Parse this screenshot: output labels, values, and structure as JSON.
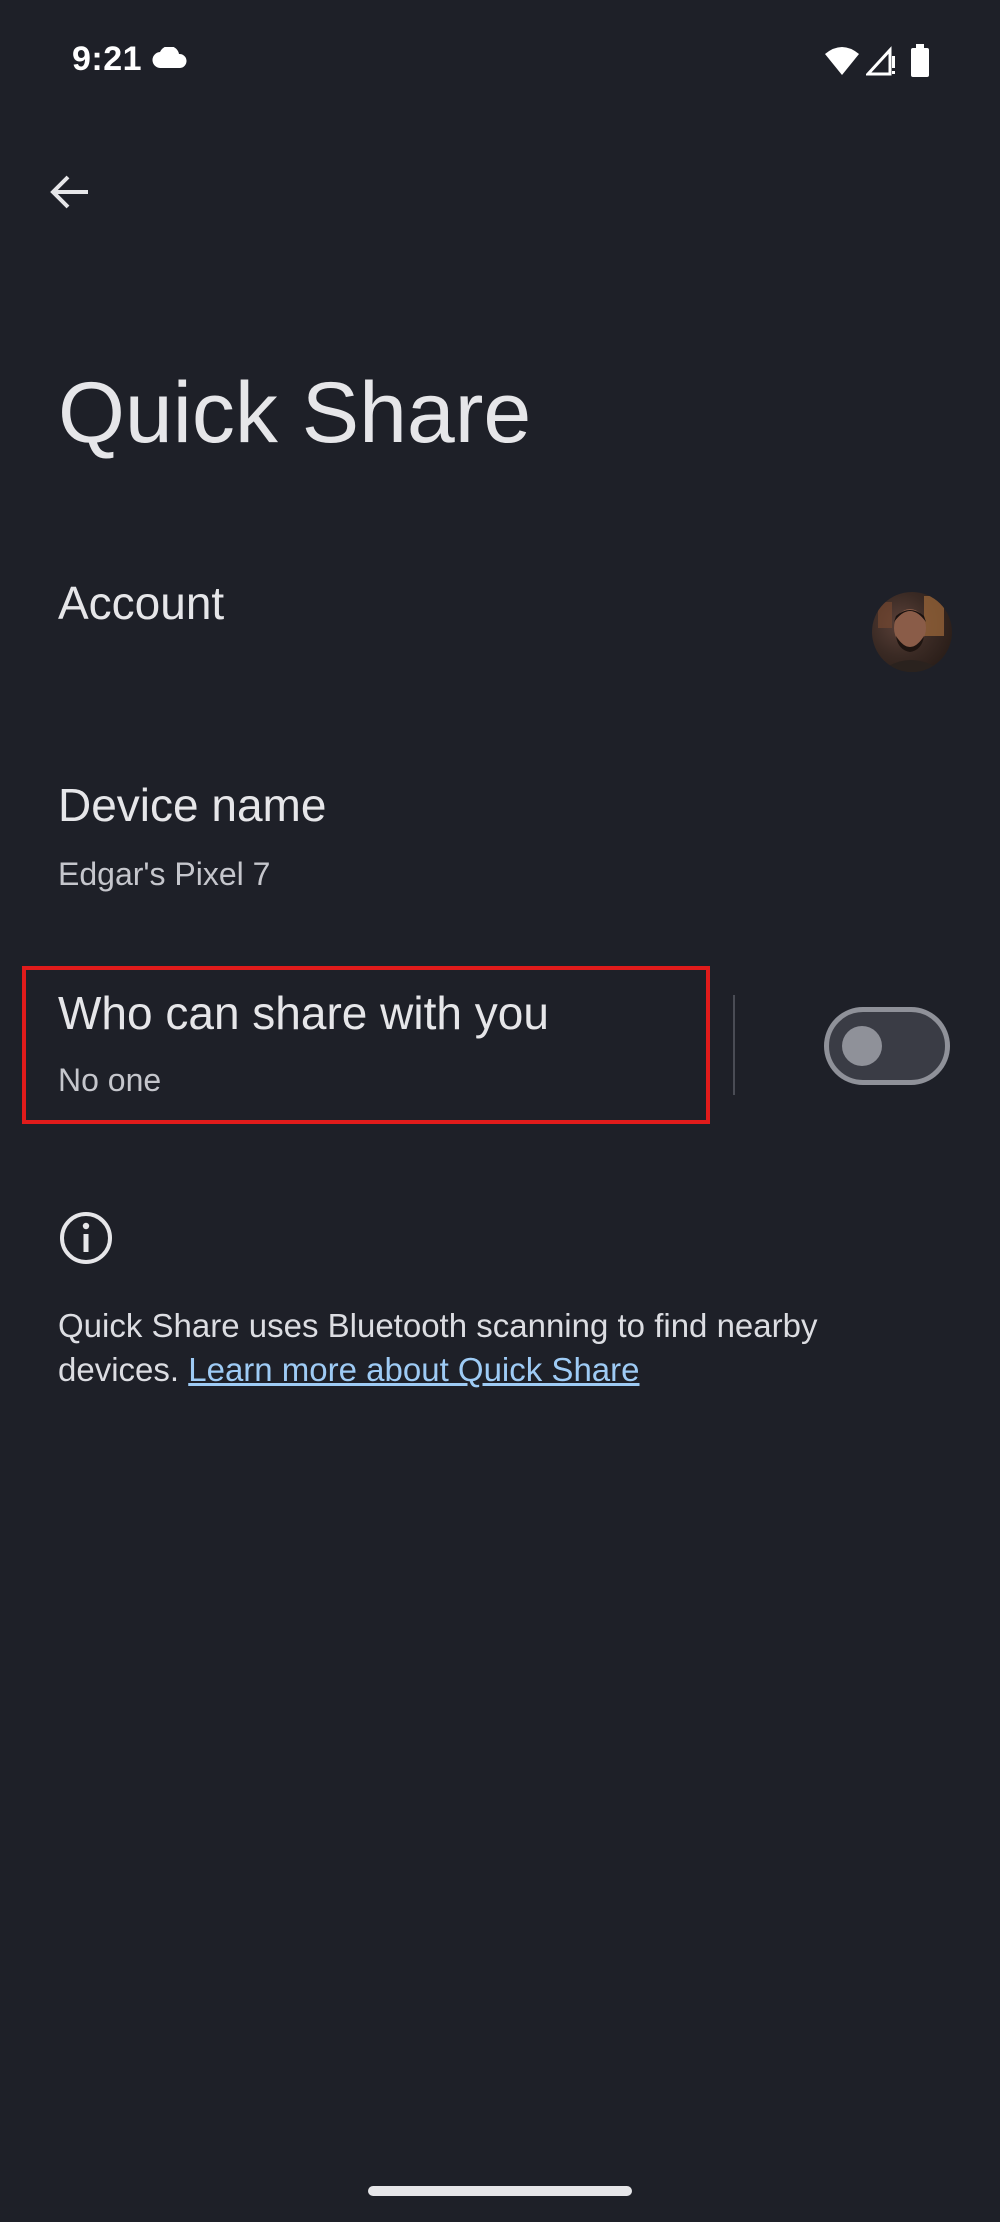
{
  "status_bar": {
    "time": "9:21",
    "icons": [
      "cloud-icon",
      "wifi-icon",
      "signal-icon",
      "battery-icon"
    ]
  },
  "header": {
    "back_icon": "arrow-back-icon",
    "title": "Quick Share"
  },
  "settings": {
    "account": {
      "title": "Account",
      "avatar_icon": "avatar"
    },
    "device_name": {
      "title": "Device name",
      "value": "Edgar's Pixel 7"
    },
    "who_can_share": {
      "title": "Who can share with you",
      "value": "No one",
      "toggle_on": false
    }
  },
  "info": {
    "icon": "info-icon",
    "text": "Quick Share uses Bluetooth scanning to find nearby devices. ",
    "link": "Learn more about Quick Share"
  },
  "colors": {
    "background": "#1e2028",
    "highlight_border": "#e01b1b",
    "link": "#9ecbf5",
    "toggle_off": "#8f9199"
  }
}
